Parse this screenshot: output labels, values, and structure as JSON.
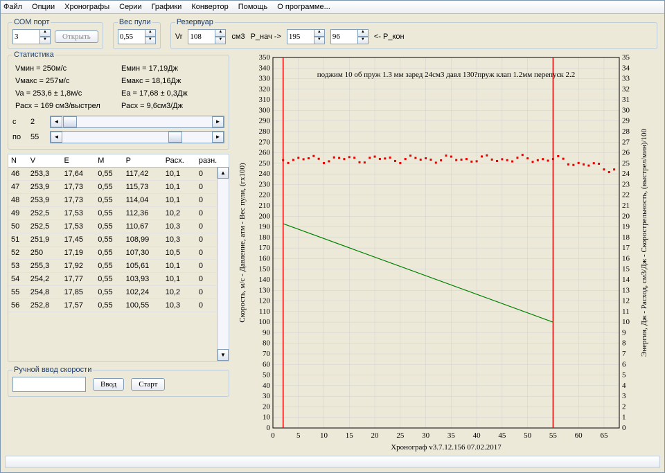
{
  "menu": [
    "Файл",
    "Опции",
    "Хронографы",
    "Серии",
    "Графики",
    "Конвертор",
    "Помощь",
    "О программе..."
  ],
  "panels": {
    "com": {
      "legend": "СОМ порт",
      "port": "3",
      "open": "Открыть"
    },
    "weight": {
      "legend": "Вес пули",
      "value": "0,55"
    },
    "reservoir": {
      "legend": "Резервуар",
      "vr_label": "Vr",
      "vr": "108",
      "vr_unit": "см3",
      "pstart_label": "Р_нач ->",
      "pstart": "195",
      "pend": "96",
      "pend_label": "<- Р_кон"
    }
  },
  "stats": {
    "legend": "Статистика",
    "vmin": "Vмин = 250м/с",
    "emin": "Eмин = 17,19Дж",
    "vmax": "Vмакс = 257м/с",
    "emax": "Eмакс = 18,16Дж",
    "va": "Va = 253,6 ± 1,8м/с",
    "ea": "Ea = 17,68 ± 0,3Дж",
    "rasx": "Расх = 169 см3/выстрел",
    "rasx2": "Расх = 9,6см3/Дж"
  },
  "sliders": {
    "from_label": "с",
    "from": "2",
    "to_label": "по",
    "to": "55"
  },
  "table": {
    "headers": [
      "N",
      "V",
      "E",
      "M",
      "P",
      "Расх.",
      "разн."
    ],
    "rows": [
      [
        "46",
        "253,3",
        "17,64",
        "0,55",
        "117,42",
        "10,1",
        "0"
      ],
      [
        "47",
        "253,9",
        "17,73",
        "0,55",
        "115,73",
        "10,1",
        "0"
      ],
      [
        "48",
        "253,9",
        "17,73",
        "0,55",
        "114,04",
        "10,1",
        "0"
      ],
      [
        "49",
        "252,5",
        "17,53",
        "0,55",
        "112,36",
        "10,2",
        "0"
      ],
      [
        "50",
        "252,5",
        "17,53",
        "0,55",
        "110,67",
        "10,3",
        "0"
      ],
      [
        "51",
        "251,9",
        "17,45",
        "0,55",
        "108,99",
        "10,3",
        "0"
      ],
      [
        "52",
        "250",
        "17,19",
        "0,55",
        "107,30",
        "10,5",
        "0"
      ],
      [
        "53",
        "255,3",
        "17,92",
        "0,55",
        "105,61",
        "10,1",
        "0"
      ],
      [
        "54",
        "254,2",
        "17,77",
        "0,55",
        "103,93",
        "10,1",
        "0"
      ],
      [
        "55",
        "254,8",
        "17,85",
        "0,55",
        "102,24",
        "10,2",
        "0"
      ],
      [
        "56",
        "252,8",
        "17,57",
        "0,55",
        "100,55",
        "10,3",
        "0"
      ]
    ]
  },
  "manual": {
    "legend": "Ручной ввод скорости",
    "enter": "Ввод",
    "start": "Старт"
  },
  "chart_data": {
    "type": "line",
    "title": "поджим 10 об пруж 1.3 мм заред 24см3 давл 130?пруж клап 1.2мм перепуск 2.2",
    "xlabel": "Хронограф v3.7.12.156     07.02.2017",
    "ylabel_left": "Скорость, м/с - Давление, атм - Вес пули, (гх100)",
    "ylabel_right": "Энергия, Дж  -  Расход, см3/Дж - Скорострельность, (выстрел/мин)/100",
    "xlim": [
      0,
      68
    ],
    "ylim_left": [
      0,
      350
    ],
    "ylim_right": [
      0,
      35
    ],
    "xticks": [
      0,
      5,
      10,
      15,
      20,
      25,
      30,
      35,
      40,
      45,
      50,
      55,
      60,
      65
    ],
    "yticks_left": [
      0,
      10,
      20,
      30,
      40,
      50,
      60,
      70,
      80,
      90,
      100,
      110,
      120,
      130,
      140,
      150,
      160,
      170,
      180,
      190,
      200,
      210,
      220,
      230,
      240,
      250,
      260,
      270,
      280,
      290,
      300,
      310,
      320,
      330,
      340,
      350
    ],
    "yticks_right": [
      0,
      1,
      2,
      3,
      4,
      5,
      6,
      7,
      8,
      9,
      10,
      11,
      12,
      13,
      14,
      15,
      16,
      17,
      18,
      19,
      20,
      21,
      22,
      23,
      24,
      25,
      26,
      27,
      28,
      29,
      30,
      31,
      32,
      33,
      34,
      35
    ],
    "vlines": [
      2,
      55
    ],
    "series": [
      {
        "name": "velocity",
        "color": "#e60000",
        "style": "dots",
        "x_range": [
          2,
          67
        ],
        "y_approx": 254,
        "y_noise": 2
      },
      {
        "name": "pressure",
        "color": "#008000",
        "style": "line",
        "points": [
          [
            2,
            193
          ],
          [
            55,
            100
          ]
        ]
      }
    ]
  }
}
